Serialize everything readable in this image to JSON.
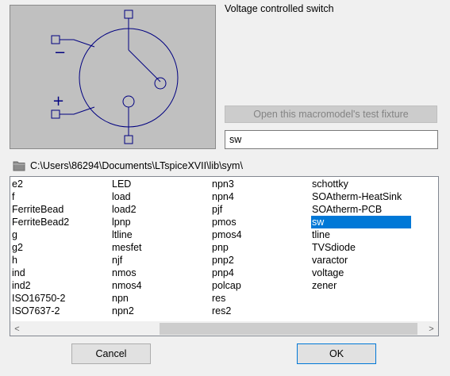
{
  "description": "Voltage controlled switch",
  "open_fixture_label": "Open this macromodel's test fixture",
  "symbol_name": "sw",
  "path": "C:\\Users\\86294\\Documents\\LTspiceXVII\\lib\\sym\\",
  "preview_symbols": {
    "minus": "−",
    "plus": "+"
  },
  "columns": [
    [
      "e2",
      "f",
      "FerriteBead",
      "FerriteBead2",
      "g",
      "g2",
      "h",
      "ind",
      "ind2",
      "ISO16750-2",
      "ISO7637-2"
    ],
    [
      "LED",
      "load",
      "load2",
      "lpnp",
      "ltline",
      "mesfet",
      "njf",
      "nmos",
      "nmos4",
      "npn",
      "npn2"
    ],
    [
      "npn3",
      "npn4",
      "pjf",
      "pmos",
      "pmos4",
      "pnp",
      "pnp2",
      "pnp4",
      "polcap",
      "res",
      "res2"
    ],
    [
      "schottky",
      "SOAtherm-HeatSink",
      "SOAtherm-PCB",
      "sw",
      "tline",
      "TVSdiode",
      "varactor",
      "voltage",
      "zener"
    ]
  ],
  "selected_item": "sw",
  "scroll_left_glyph": "<",
  "scroll_right_glyph": ">",
  "cancel_label": "Cancel",
  "ok_label": "OK",
  "colors": {
    "symbol": "#000080",
    "selection": "#0078d7",
    "preview_bg": "#c0c0c0"
  }
}
